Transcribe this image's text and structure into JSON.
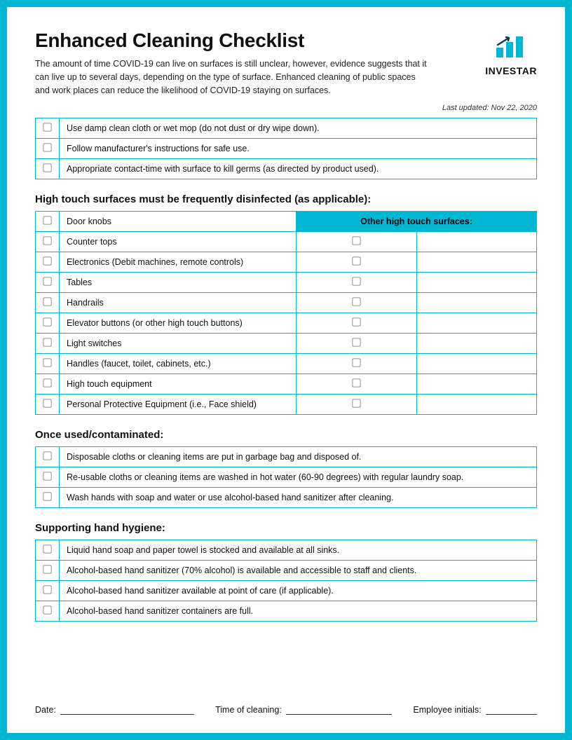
{
  "header": {
    "title": "Enhanced Cleaning Checklist",
    "intro": "The amount of time COVID-19 can live on surfaces is still unclear, however, evidence suggests that it can live up to several days, depending on the type of surface. Enhanced cleaning of public spaces and work places can reduce the likelihood of COVID-19 staying on surfaces.",
    "brand": "INVESTAR",
    "last_updated": "Last updated: Nov 22, 2020"
  },
  "colors": {
    "accent": "#00b8d4"
  },
  "sections": {
    "intro_items": [
      "Use damp clean cloth or wet mop (do not dust or dry wipe down).",
      "Follow manufacturer's instructions for safe use.",
      "Appropriate contact-time with surface to kill germs (as directed by product used)."
    ],
    "high_touch": {
      "heading": "High touch surfaces must be frequently disinfected (as applicable):",
      "other_header": "Other high touch surfaces:",
      "items": [
        "Door knobs",
        "Counter tops",
        "Electronics (Debit machines, remote controls)",
        "Tables",
        "Handrails",
        "Elevator buttons (or other high touch buttons)",
        "Light switches",
        "Handles (faucet, toilet, cabinets, etc.)",
        "High touch equipment",
        "Personal Protective Equipment (i.e., Face shield)"
      ]
    },
    "once_used": {
      "heading": "Once used/contaminated:",
      "items": [
        "Disposable cloths or cleaning items are put in garbage bag and disposed of.",
        "Re-usable cloths or cleaning items are washed in hot water (60-90 degrees) with regular laundry soap.",
        "Wash hands with soap and water or use alcohol-based hand sanitizer after cleaning."
      ]
    },
    "hand_hygiene": {
      "heading": "Supporting hand hygiene:",
      "items": [
        "Liquid hand soap and paper towel is stocked and available at all sinks.",
        "Alcohol-based hand sanitizer (70% alcohol) is available and accessible to staff and clients.",
        "Alcohol-based hand sanitizer available at point of care (if applicable).",
        "Alcohol-based hand sanitizer containers are full."
      ]
    }
  },
  "footer": {
    "date_label": "Date:",
    "time_label": "Time of cleaning:",
    "initials_label": "Employee initials:"
  }
}
